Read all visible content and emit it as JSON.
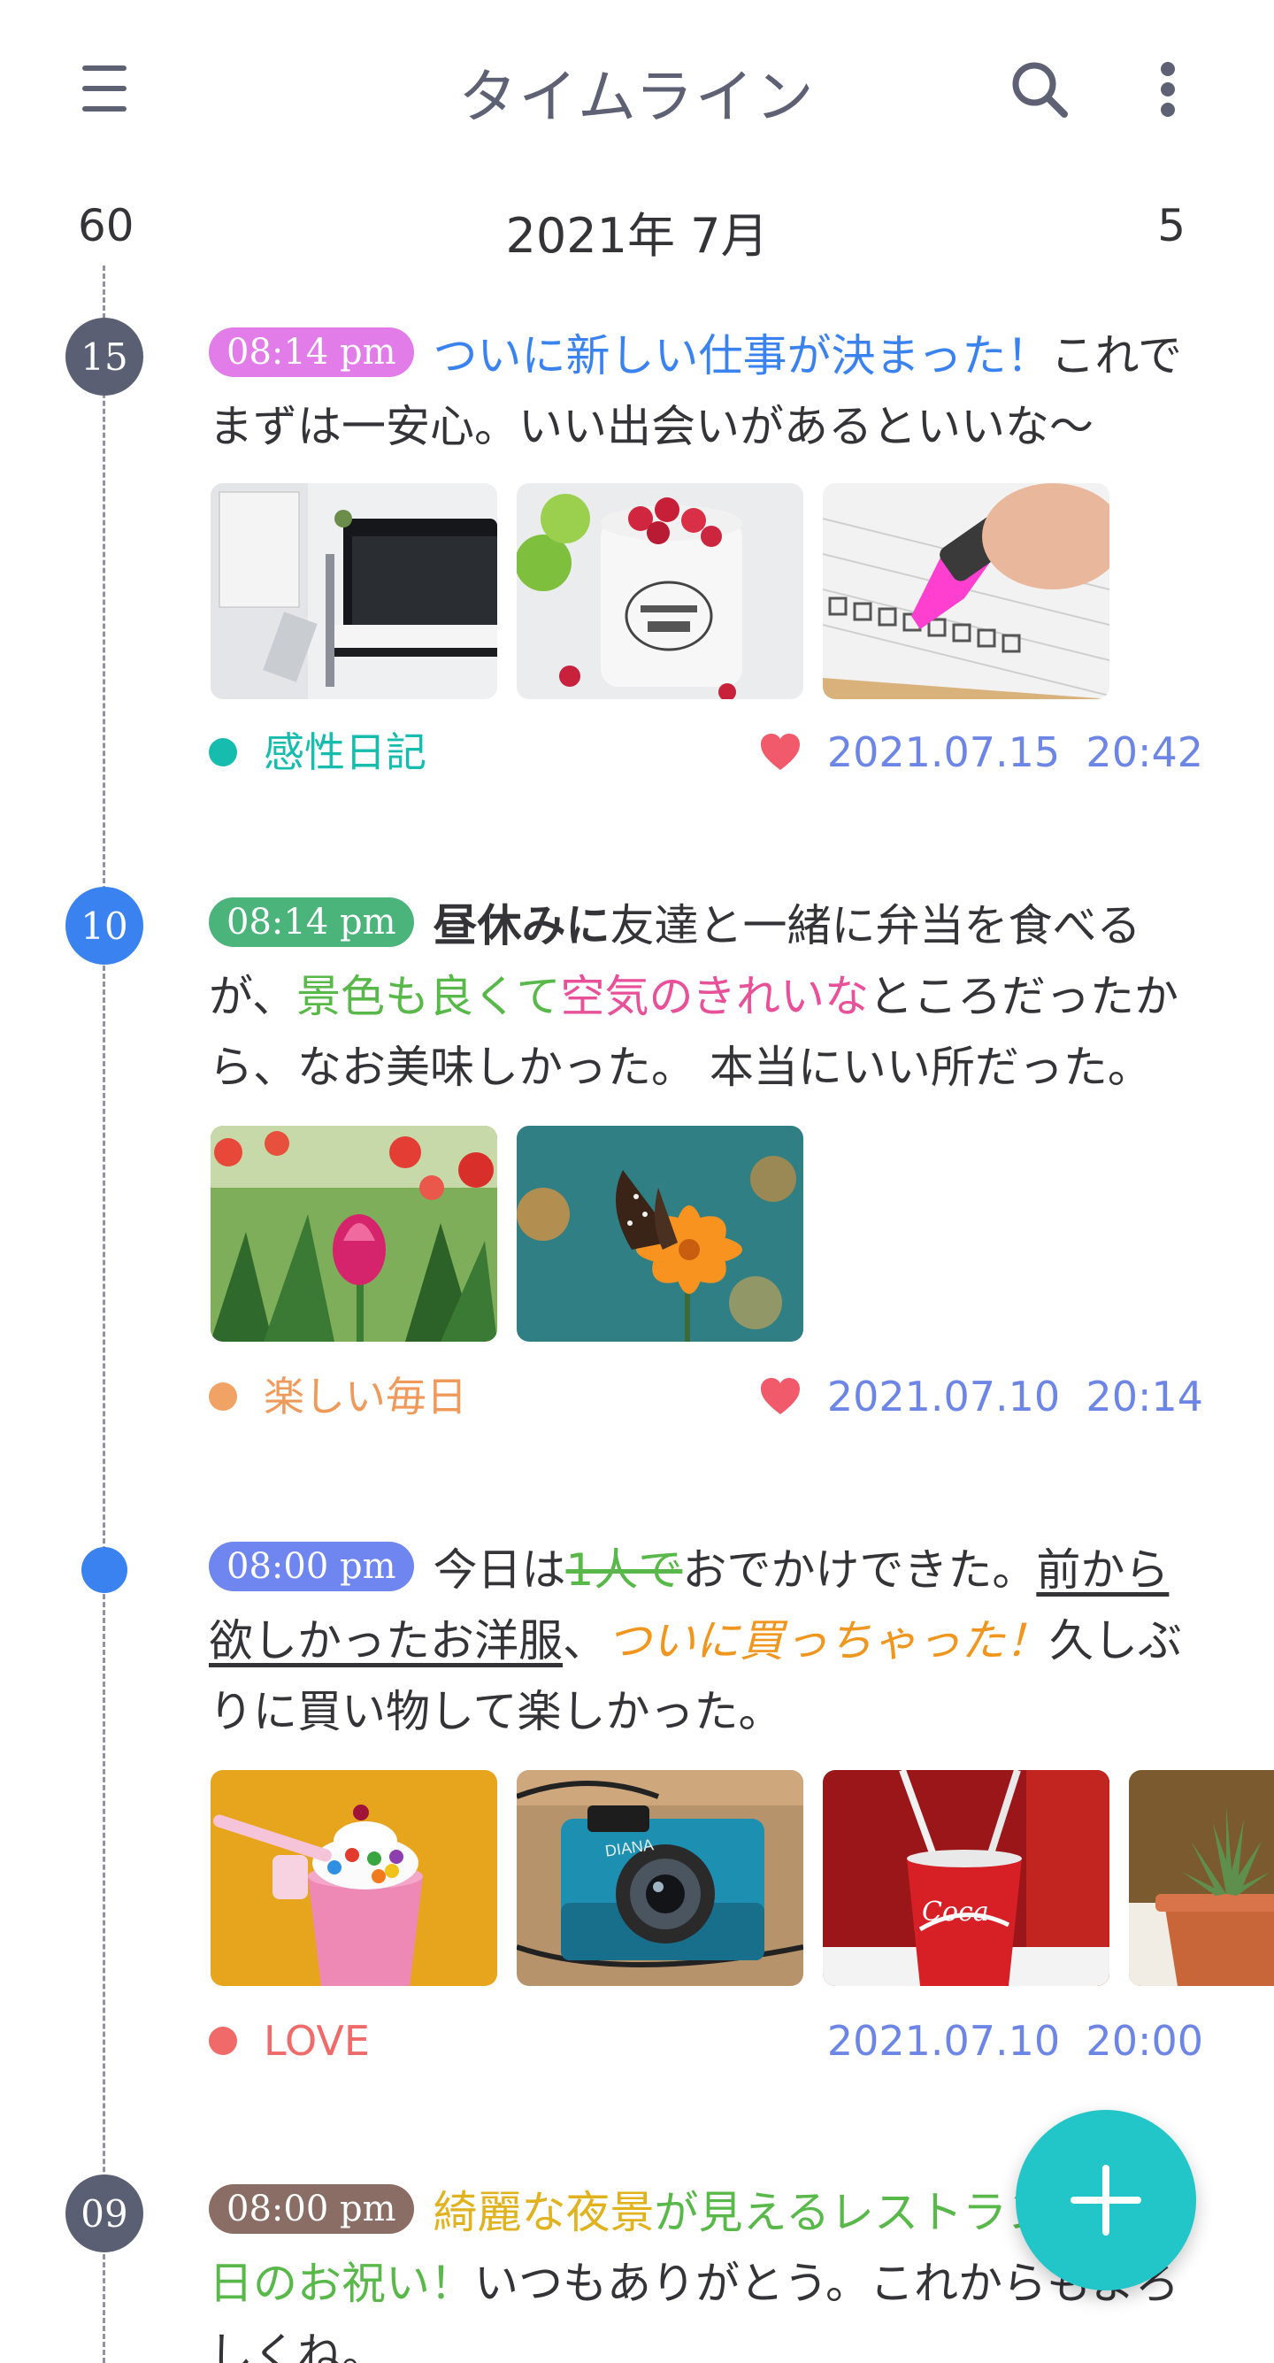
{
  "header": {
    "title": "タイムライン",
    "icons": {
      "menu": "hamburger-menu-icon",
      "search": "search-icon",
      "more": "more-vert-icon"
    },
    "count_left": "60",
    "month": "2021年 7月",
    "count_right": "5"
  },
  "colors": {
    "accent": "#23c6c8",
    "text": "#333338",
    "date": "#6d86e6",
    "heart": "#f05a6a"
  },
  "entries": [
    {
      "day": "15",
      "time": "08:14 pm",
      "segments": [
        "ついに新しい仕事が決まった！",
        "これでまずは一安心。いい出会いがあるといいな～"
      ],
      "photos": [
        "desk-planner-photo",
        "raspberry-mug-photo",
        "checklist-marker-photo"
      ],
      "category": "感性日記",
      "favorite": true,
      "date": "2021.07.15  20:42"
    },
    {
      "day": "10",
      "time": "08:14 pm",
      "segments": [
        "昼休みに",
        "友達と一緒に弁当を食べるが、",
        "景色も良くて",
        "空気のきれいな",
        "ところだったから、なお美味しかった。 本当にいい所だった。"
      ],
      "photos": [
        "tulips-photo",
        "butterfly-flower-photo"
      ],
      "category": "楽しい毎日",
      "favorite": true,
      "date": "2021.07.10  20:14"
    },
    {
      "day": "",
      "time": "08:00 pm",
      "segments": [
        "今日は",
        "1人で",
        "おでかけできた。",
        "前から欲しかったお洋服",
        "、",
        "ついに買っちゃった！",
        "久しぶりに買い物して楽しかった。"
      ],
      "photos": [
        "milkshake-photo",
        "camera-photo",
        "cola-cup-photo",
        "succulent-photo"
      ],
      "category": "LOVE",
      "favorite": false,
      "date": "2021.07.10  20:00"
    },
    {
      "day": "09",
      "time": "08:00 pm",
      "segments": [
        "綺麗な夜景",
        "が見えるレストランで",
        "記念日のお祝い！",
        "いつもありがとう。これからもよろしくね。"
      ],
      "photos": [],
      "category": "",
      "favorite": false,
      "date": ""
    }
  ],
  "fab": {
    "icon": "plus-icon"
  }
}
